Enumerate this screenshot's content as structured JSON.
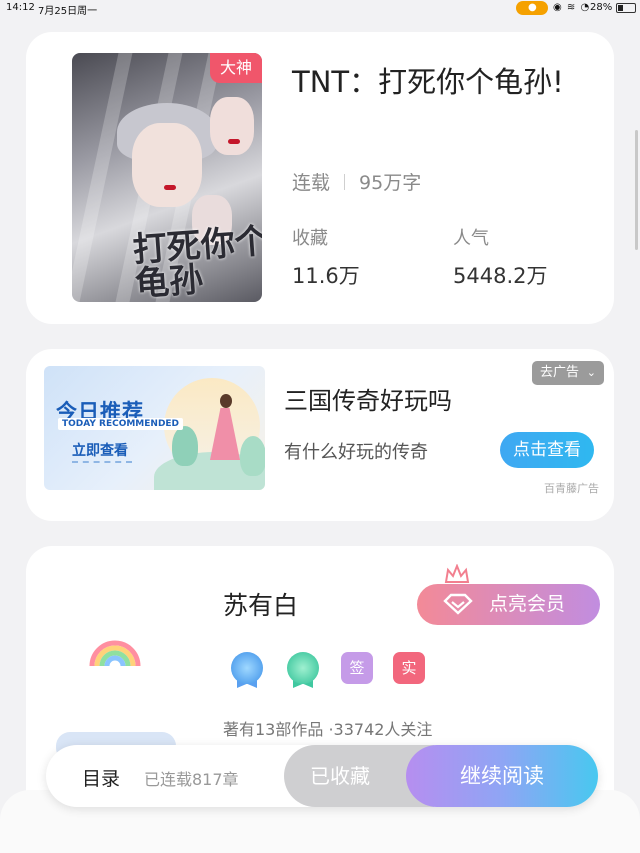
{
  "status_bar": {
    "time": "14:12",
    "date": "7月25日周一",
    "battery": "28%"
  },
  "book": {
    "badge": "大神",
    "cover_art_text": "打死你个\n龟孙",
    "title": "TNT：打死你个龟孙!",
    "status": "连载",
    "word_count": "95万字",
    "stats": [
      {
        "label": "收藏",
        "value": "11.6万"
      },
      {
        "label": "人气",
        "value": "5448.2万"
      }
    ]
  },
  "ad": {
    "image_headline": "今日推荐",
    "image_subline": "TODAY RECOMMENDED",
    "image_cta": "立即查看",
    "title": "三国传奇好玩吗",
    "description": "有什么好玩的传奇",
    "close_label": "去广告",
    "button_label": "点击查看",
    "source": "百青藤广告"
  },
  "author": {
    "name": "苏有白",
    "vip_button": "点亮会员",
    "tags": [
      "签",
      "实"
    ],
    "stats": "著有13部作品 ·33742人关注"
  },
  "bottom_bar": {
    "toc_label": "目录",
    "toc_status": "已连载817章",
    "collected_label": "已收藏",
    "read_label": "继续阅读"
  },
  "colors": {
    "badge": "#f0566b",
    "ad_button": "#3fa8f2",
    "vip_gradient": [
      "#f38a97",
      "#c18de0"
    ],
    "read_gradient": [
      "#b68ef0",
      "#48c8f0"
    ],
    "tag_sign": "#c59be8",
    "tag_real": "#f2677d"
  }
}
